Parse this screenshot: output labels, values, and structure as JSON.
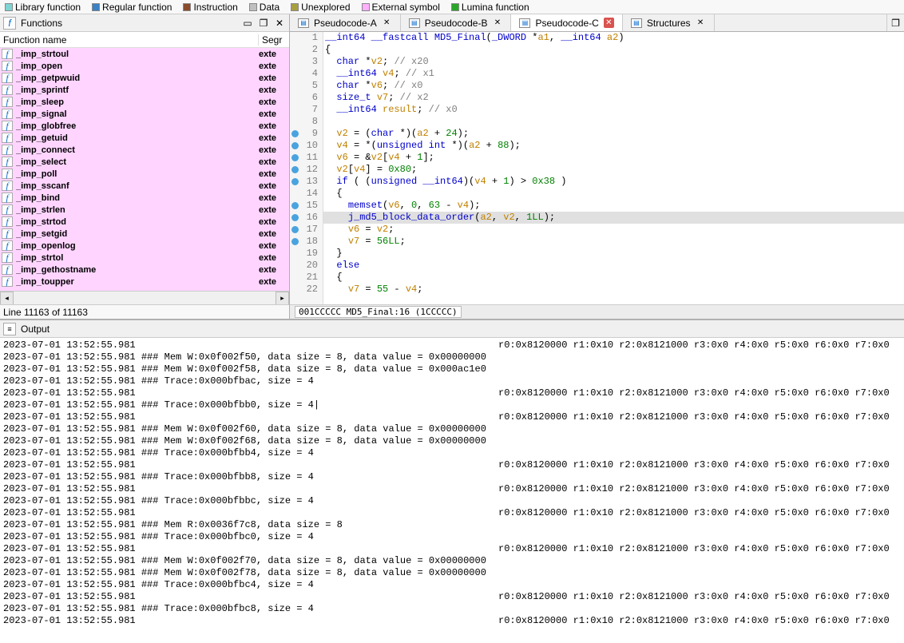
{
  "legend": [
    {
      "label": "Library function",
      "color": "#7fd4d4"
    },
    {
      "label": "Regular function",
      "color": "#3b7fc4"
    },
    {
      "label": "Instruction",
      "color": "#8b4a2b"
    },
    {
      "label": "Data",
      "color": "#c0c0c0"
    },
    {
      "label": "Unexplored",
      "color": "#a8a040"
    },
    {
      "label": "External symbol",
      "color": "#ffb0ff"
    },
    {
      "label": "Lumina function",
      "color": "#2aa62a"
    }
  ],
  "functions_panel": {
    "title": "Functions",
    "col1": "Function name",
    "col2": "Segr",
    "rows": [
      {
        "name": "_imp_strtoul",
        "seg": "exte"
      },
      {
        "name": "_imp_open",
        "seg": "exte"
      },
      {
        "name": "_imp_getpwuid",
        "seg": "exte"
      },
      {
        "name": "_imp_sprintf",
        "seg": "exte"
      },
      {
        "name": "_imp_sleep",
        "seg": "exte"
      },
      {
        "name": "_imp_signal",
        "seg": "exte"
      },
      {
        "name": "_imp_globfree",
        "seg": "exte"
      },
      {
        "name": "_imp_getuid",
        "seg": "exte"
      },
      {
        "name": "_imp_connect",
        "seg": "exte"
      },
      {
        "name": "_imp_select",
        "seg": "exte"
      },
      {
        "name": "_imp_poll",
        "seg": "exte"
      },
      {
        "name": "_imp_sscanf",
        "seg": "exte"
      },
      {
        "name": "_imp_bind",
        "seg": "exte"
      },
      {
        "name": "_imp_strlen",
        "seg": "exte"
      },
      {
        "name": "_imp_strtod",
        "seg": "exte"
      },
      {
        "name": "_imp_setgid",
        "seg": "exte"
      },
      {
        "name": "_imp_openlog",
        "seg": "exte"
      },
      {
        "name": "_imp_strtol",
        "seg": "exte"
      },
      {
        "name": "_imp_gethostname",
        "seg": "exte"
      },
      {
        "name": "_imp_toupper",
        "seg": "exte"
      }
    ],
    "status": "Line 11163 of 11163"
  },
  "tabs": [
    {
      "label": "Pseudocode-A",
      "active": false
    },
    {
      "label": "Pseudocode-B",
      "active": false
    },
    {
      "label": "Pseudocode-C",
      "active": true
    },
    {
      "label": "Structures",
      "active": false
    }
  ],
  "code": {
    "lines": [
      {
        "n": 1,
        "bp": false,
        "html": "<span class='ty'>__int64</span> <span class='kw'>__fastcall</span> <span class='fn'>MD5_Final</span>(<span class='ty'>_DWORD</span> *<span class='var'>a1</span>, <span class='ty'>__int64</span> <span class='var'>a2</span>)"
      },
      {
        "n": 2,
        "bp": false,
        "html": "{"
      },
      {
        "n": 3,
        "bp": false,
        "html": "  <span class='ty'>char</span> *<span class='var'>v2</span>; <span class='cmt'>// x20</span>"
      },
      {
        "n": 4,
        "bp": false,
        "html": "  <span class='ty'>__int64</span> <span class='var'>v4</span>; <span class='cmt'>// x1</span>"
      },
      {
        "n": 5,
        "bp": false,
        "html": "  <span class='ty'>char</span> *<span class='var'>v6</span>; <span class='cmt'>// x0</span>"
      },
      {
        "n": 6,
        "bp": false,
        "html": "  <span class='ty'>size_t</span> <span class='var'>v7</span>; <span class='cmt'>// x2</span>"
      },
      {
        "n": 7,
        "bp": false,
        "html": "  <span class='ty'>__int64</span> <span class='var'>result</span>; <span class='cmt'>// x0</span>"
      },
      {
        "n": 8,
        "bp": false,
        "html": ""
      },
      {
        "n": 9,
        "bp": true,
        "html": "  <span class='var'>v2</span> = (<span class='ty'>char</span> *)(<span class='var'>a2</span> + <span class='num'>24</span>);"
      },
      {
        "n": 10,
        "bp": true,
        "html": "  <span class='var'>v4</span> = *(<span class='ty'>unsigned int</span> *)(<span class='var'>a2</span> + <span class='num'>88</span>);"
      },
      {
        "n": 11,
        "bp": true,
        "html": "  <span class='var'>v6</span> = &amp;<span class='var'>v2</span>[<span class='var'>v4</span> + <span class='num'>1</span>];"
      },
      {
        "n": 12,
        "bp": true,
        "html": "  <span class='var'>v2</span>[<span class='var'>v4</span>] = <span class='num'>0x80</span>;"
      },
      {
        "n": 13,
        "bp": true,
        "html": "  <span class='kw'>if</span> ( (<span class='ty'>unsigned __int64</span>)(<span class='var'>v4</span> + <span class='num'>1</span>) &gt; <span class='num'>0x38</span> )"
      },
      {
        "n": 14,
        "bp": false,
        "html": "  {"
      },
      {
        "n": 15,
        "bp": true,
        "html": "    <span class='func-call'>memset</span>(<span class='var'>v6</span>, <span class='num'>0</span>, <span class='num'>63</span> - <span class='var'>v4</span>);"
      },
      {
        "n": 16,
        "bp": true,
        "hl": true,
        "html": "    <span class='func-call'>j_md5_block_data_order</span>(<span class='arg'>a2</span>, <span class='arg'>v2</span>, <span class='num'>1LL</span>);"
      },
      {
        "n": 17,
        "bp": true,
        "html": "    <span class='var'>v6</span> = <span class='var'>v2</span>;"
      },
      {
        "n": 18,
        "bp": true,
        "html": "    <span class='var'>v7</span> = <span class='num'>56LL</span>;"
      },
      {
        "n": 19,
        "bp": false,
        "html": "  }"
      },
      {
        "n": 20,
        "bp": false,
        "html": "  <span class='kw'>else</span>"
      },
      {
        "n": 21,
        "bp": false,
        "html": "  {"
      },
      {
        "n": 22,
        "bp": false,
        "html": "    <span class='var'>v7</span> = <span class='num'>55</span> - <span class='var'>v4</span>;"
      }
    ],
    "status": "001CCCCC MD5_Final:16 (1CCCCC)"
  },
  "output": {
    "title": "Output",
    "regs": "r0:0x8120000 r1:0x10 r2:0x8121000 r3:0x0 r4:0x0 r5:0x0 r6:0x0 r7:0x0",
    "lines": [
      {
        "t": "2023-07-01 13:52:55.981",
        "m": "",
        "r": true
      },
      {
        "t": "2023-07-01 13:52:55.981",
        "m": "### Mem W:0x0f002f50, data size = 8, data value = 0x00000000",
        "r": false
      },
      {
        "t": "2023-07-01 13:52:55.981",
        "m": "### Mem W:0x0f002f58, data size = 8, data value = 0x000ac1e0",
        "r": false
      },
      {
        "t": "2023-07-01 13:52:55.981",
        "m": "### Trace:0x000bfbac, size = 4",
        "r": false
      },
      {
        "t": "2023-07-01 13:52:55.981",
        "m": "",
        "r": true
      },
      {
        "t": "2023-07-01 13:52:55.981",
        "m": "### Trace:0x000bfbb0, size = 4|",
        "r": false
      },
      {
        "t": "2023-07-01 13:52:55.981",
        "m": "",
        "r": true
      },
      {
        "t": "2023-07-01 13:52:55.981",
        "m": "### Mem W:0x0f002f60, data size = 8, data value = 0x00000000",
        "r": false
      },
      {
        "t": "2023-07-01 13:52:55.981",
        "m": "### Mem W:0x0f002f68, data size = 8, data value = 0x00000000",
        "r": false
      },
      {
        "t": "2023-07-01 13:52:55.981",
        "m": "### Trace:0x000bfbb4, size = 4",
        "r": false
      },
      {
        "t": "2023-07-01 13:52:55.981",
        "m": "",
        "r": true
      },
      {
        "t": "2023-07-01 13:52:55.981",
        "m": "### Trace:0x000bfbb8, size = 4",
        "r": false
      },
      {
        "t": "2023-07-01 13:52:55.981",
        "m": "",
        "r": true
      },
      {
        "t": "2023-07-01 13:52:55.981",
        "m": "### Trace:0x000bfbbc, size = 4",
        "r": false
      },
      {
        "t": "2023-07-01 13:52:55.981",
        "m": "",
        "r": true
      },
      {
        "t": "2023-07-01 13:52:55.981",
        "m": "### Mem R:0x0036f7c8, data size = 8",
        "r": false
      },
      {
        "t": "2023-07-01 13:52:55.981",
        "m": "### Trace:0x000bfbc0, size = 4",
        "r": false
      },
      {
        "t": "2023-07-01 13:52:55.981",
        "m": "",
        "r": true
      },
      {
        "t": "2023-07-01 13:52:55.981",
        "m": "### Mem W:0x0f002f70, data size = 8, data value = 0x00000000",
        "r": false
      },
      {
        "t": "2023-07-01 13:52:55.981",
        "m": "### Mem W:0x0f002f78, data size = 8, data value = 0x00000000",
        "r": false
      },
      {
        "t": "2023-07-01 13:52:55.981",
        "m": "### Trace:0x000bfbc4, size = 4",
        "r": false
      },
      {
        "t": "2023-07-01 13:52:55.981",
        "m": "",
        "r": true
      },
      {
        "t": "2023-07-01 13:52:55.981",
        "m": "### Trace:0x000bfbc8, size = 4",
        "r": false
      },
      {
        "t": "2023-07-01 13:52:55.981",
        "m": "",
        "r": true
      }
    ]
  }
}
